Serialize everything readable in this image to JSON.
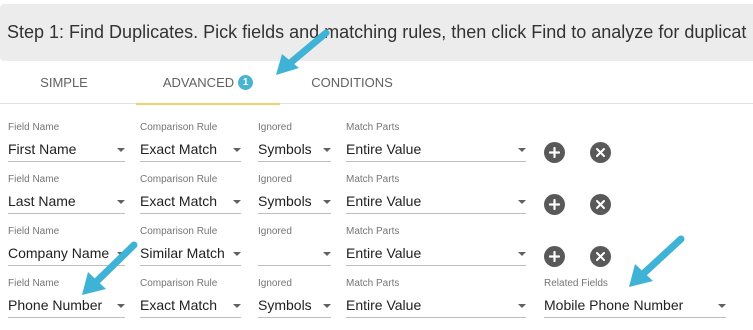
{
  "step": {
    "text": "Step 1: Find Duplicates. Pick fields and matching rules, then click Find to analyze for duplicat"
  },
  "tabs": [
    {
      "label": "SIMPLE",
      "active": false
    },
    {
      "label": "ADVANCED",
      "active": true,
      "badge": "1"
    },
    {
      "label": "CONDITIONS",
      "active": false
    }
  ],
  "labels": {
    "field_name": "Field Name",
    "comparison_rule": "Comparison Rule",
    "ignored": "Ignored",
    "match_parts": "Match Parts",
    "related_fields": "Related Fields"
  },
  "rows": [
    {
      "field": "First Name",
      "comparison": "Exact Match",
      "ignored": "Symbols",
      "match_parts": "Entire Value"
    },
    {
      "field": "Last Name",
      "comparison": "Exact Match",
      "ignored": "Symbols",
      "match_parts": "Entire Value"
    },
    {
      "field": "Company Name",
      "comparison": "Similar Match",
      "ignored": "",
      "match_parts": "Entire Value"
    },
    {
      "field": "Phone Number",
      "comparison": "Exact Match",
      "ignored": "Symbols",
      "match_parts": "Entire Value",
      "related_fields": "Mobile Phone Number"
    }
  ],
  "colors": {
    "accent": "#4ab3d1",
    "tab_underline": "#f2d16b",
    "step_bar": "#ececec",
    "icon_button": "#595959"
  },
  "icons": {
    "add": "plus-circle-icon",
    "remove": "x-circle-icon",
    "dropdown": "caret-down-icon",
    "annotation": "arrow-icon"
  }
}
